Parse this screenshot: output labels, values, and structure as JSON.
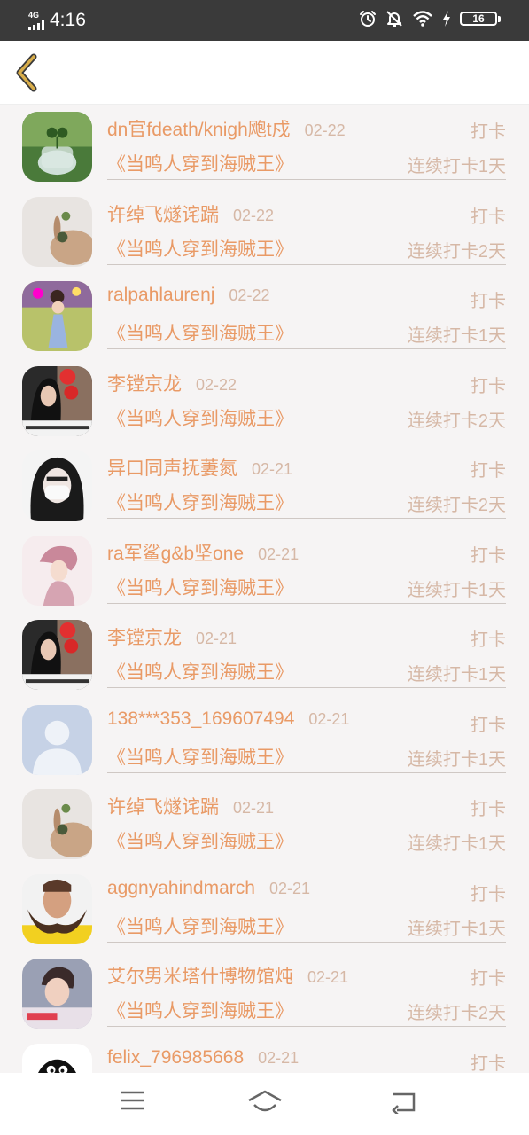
{
  "status_bar": {
    "network": "4G",
    "time": "4:16",
    "battery": "16",
    "icons": [
      "signal-icon",
      "alarm-icon",
      "mute-icon",
      "wifi-icon",
      "charging-icon",
      "battery-icon"
    ]
  },
  "nav": {
    "back_icon": "chevron-left-icon"
  },
  "theme": {
    "accent": "#e99a66",
    "muted": "#d6b8a6",
    "back_icon": "#c8a03e"
  },
  "rows": [
    {
      "user": "dn官fdeath/knigh飑t戍",
      "date": "02-22",
      "action": "打卡",
      "book": "《当鸣人穿到海贼王》",
      "streak": "连续打卡1天",
      "avatar": "plant-jar"
    },
    {
      "user": "许绰飞燧诧踹",
      "date": "02-22",
      "action": "打卡",
      "book": "《当鸣人穿到海贼王》",
      "streak": "连续打卡2天",
      "avatar": "rabbit"
    },
    {
      "user": "ralpahlaurenj",
      "date": "02-22",
      "action": "打卡",
      "book": "《当鸣人穿到海贼王》",
      "streak": "连续打卡1天",
      "avatar": "girl-field"
    },
    {
      "user": "李镗京龙",
      "date": "02-22",
      "action": "打卡",
      "book": "《当鸣人穿到海贼王》",
      "streak": "连续打卡2天",
      "avatar": "girl-lantern"
    },
    {
      "user": "异口同声抚萋氮",
      "date": "02-21",
      "action": "打卡",
      "book": "《当鸣人穿到海贼王》",
      "streak": "连续打卡2天",
      "avatar": "girl-mask"
    },
    {
      "user": "ra军鲨g&b坚one",
      "date": "02-21",
      "action": "打卡",
      "book": "《当鸣人穿到海贼王》",
      "streak": "连续打卡1天",
      "avatar": "illustration"
    },
    {
      "user": "李镗京龙",
      "date": "02-21",
      "action": "打卡",
      "book": "《当鸣人穿到海贼王》",
      "streak": "连续打卡1天",
      "avatar": "girl-lantern"
    },
    {
      "user": "138***353_169607494",
      "date": "02-21",
      "action": "打卡",
      "book": "《当鸣人穿到海贼王》",
      "streak": "连续打卡1天",
      "avatar": "default"
    },
    {
      "user": "许绰飞燧诧踹",
      "date": "02-21",
      "action": "打卡",
      "book": "《当鸣人穿到海贼王》",
      "streak": "连续打卡1天",
      "avatar": "rabbit"
    },
    {
      "user": "aggnyahindmarch",
      "date": "02-21",
      "action": "打卡",
      "book": "《当鸣人穿到海贼王》",
      "streak": "连续打卡1天",
      "avatar": "beard-man"
    },
    {
      "user": "艾尔男米塔什博物馆炖",
      "date": "02-21",
      "action": "打卡",
      "book": "《当鸣人穿到海贼王》",
      "streak": "连续打卡2天",
      "avatar": "boy-photo"
    },
    {
      "user": "felix_796985668",
      "date": "02-21",
      "action": "打卡",
      "book": "",
      "streak": "",
      "avatar": "penguin"
    }
  ],
  "bottom_nav": {
    "icons": [
      "menu-icon",
      "home-icon",
      "back-icon"
    ]
  }
}
